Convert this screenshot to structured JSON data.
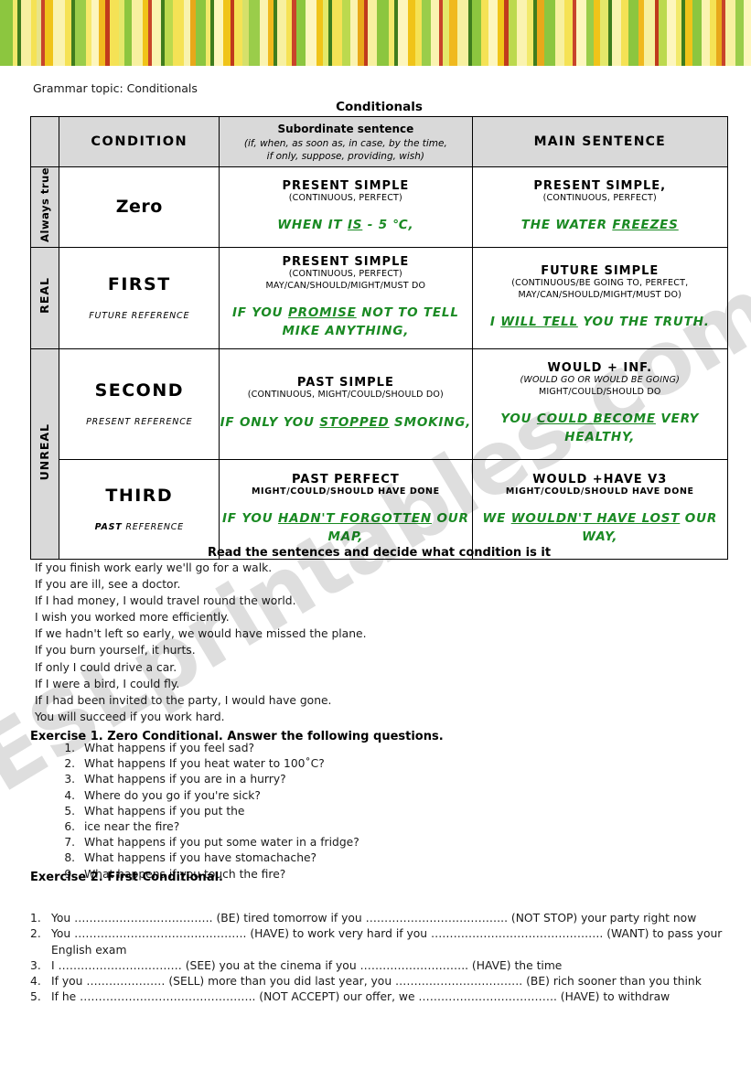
{
  "banner": {
    "name": "decorative-stripe-banner",
    "stripes": [
      {
        "c": "#8cc63f",
        "w": 14
      },
      {
        "c": "#f2e96b",
        "w": 5
      },
      {
        "c": "#3f7d1e",
        "w": 4
      },
      {
        "c": "#f7f0a0",
        "w": 11
      },
      {
        "c": "#f5e255",
        "w": 6
      },
      {
        "c": "#e8e48a",
        "w": 5
      },
      {
        "c": "#c8442a",
        "w": 4
      },
      {
        "c": "#f0c419",
        "w": 9
      },
      {
        "c": "#faf3b0",
        "w": 13
      },
      {
        "c": "#f5e255",
        "w": 7
      },
      {
        "c": "#3f7d1e",
        "w": 4
      },
      {
        "c": "#9acd4a",
        "w": 12
      },
      {
        "c": "#f7e96b",
        "w": 6
      },
      {
        "c": "#fdf6bd",
        "w": 9
      },
      {
        "c": "#f0b91e",
        "w": 7
      },
      {
        "c": "#c03a1c",
        "w": 5
      },
      {
        "c": "#f5e255",
        "w": 10
      },
      {
        "c": "#e4e86a",
        "w": 6
      },
      {
        "c": "#8cc63f",
        "w": 8
      },
      {
        "c": "#f7f0a0",
        "w": 12
      },
      {
        "c": "#f0c419",
        "w": 6
      },
      {
        "c": "#c8442a",
        "w": 4
      },
      {
        "c": "#faf3b0",
        "w": 10
      },
      {
        "c": "#3f7d1e",
        "w": 4
      },
      {
        "c": "#bcd94e",
        "w": 9
      },
      {
        "c": "#f5e255",
        "w": 12
      },
      {
        "c": "#f8f2ae",
        "w": 7
      },
      {
        "c": "#e8a81a",
        "w": 6
      },
      {
        "c": "#8cc63f",
        "w": 11
      },
      {
        "c": "#f2e96b",
        "w": 5
      },
      {
        "c": "#3f7d1e",
        "w": 4
      },
      {
        "c": "#fdf6bd",
        "w": 10
      },
      {
        "c": "#f0c419",
        "w": 8
      },
      {
        "c": "#c03a1c",
        "w": 4
      },
      {
        "c": "#f5e255",
        "w": 9
      },
      {
        "c": "#d6e06a",
        "w": 7
      },
      {
        "c": "#9acd4a",
        "w": 12
      },
      {
        "c": "#faf3b0",
        "w": 9
      },
      {
        "c": "#f0b91e",
        "w": 6
      },
      {
        "c": "#3f7d1e",
        "w": 4
      },
      {
        "c": "#f7f0a0",
        "w": 11
      },
      {
        "c": "#f5e255",
        "w": 6
      },
      {
        "c": "#c8442a",
        "w": 5
      },
      {
        "c": "#8cc63f",
        "w": 10
      },
      {
        "c": "#fdf6bd",
        "w": 12
      },
      {
        "c": "#f0c419",
        "w": 7
      },
      {
        "c": "#e4e86a",
        "w": 6
      },
      {
        "c": "#3f7d1e",
        "w": 4
      },
      {
        "c": "#f5e255",
        "w": 11
      },
      {
        "c": "#bcd94e",
        "w": 9
      },
      {
        "c": "#faf3b0",
        "w": 8
      },
      {
        "c": "#e8a81a",
        "w": 7
      },
      {
        "c": "#c03a1c",
        "w": 4
      },
      {
        "c": "#f7f0a0",
        "w": 10
      },
      {
        "c": "#8cc63f",
        "w": 13
      },
      {
        "c": "#f2e96b",
        "w": 6
      },
      {
        "c": "#3f7d1e",
        "w": 4
      },
      {
        "c": "#fdf6bd",
        "w": 11
      },
      {
        "c": "#f0c419",
        "w": 8
      },
      {
        "c": "#f5e255",
        "w": 7
      },
      {
        "c": "#9acd4a",
        "w": 10
      },
      {
        "c": "#faf3b0",
        "w": 9
      },
      {
        "c": "#c8442a",
        "w": 4
      },
      {
        "c": "#e4e86a",
        "w": 7
      },
      {
        "c": "#f0b91e",
        "w": 9
      },
      {
        "c": "#f7f0a0",
        "w": 12
      },
      {
        "c": "#3f7d1e",
        "w": 4
      },
      {
        "c": "#8cc63f",
        "w": 11
      },
      {
        "c": "#f5e255",
        "w": 8
      },
      {
        "c": "#fdf6bd",
        "w": 10
      },
      {
        "c": "#f0c419",
        "w": 7
      },
      {
        "c": "#c03a1c",
        "w": 5
      },
      {
        "c": "#bcd94e",
        "w": 9
      },
      {
        "c": "#faf3b0",
        "w": 11
      },
      {
        "c": "#f2e96b",
        "w": 7
      },
      {
        "c": "#3f7d1e",
        "w": 4
      },
      {
        "c": "#e8a81a",
        "w": 8
      },
      {
        "c": "#8cc63f",
        "w": 12
      },
      {
        "c": "#f7f0a0",
        "w": 10
      },
      {
        "c": "#f5e255",
        "w": 9
      },
      {
        "c": "#c8442a",
        "w": 4
      },
      {
        "c": "#fdf6bd",
        "w": 11
      },
      {
        "c": "#9acd4a",
        "w": 8
      },
      {
        "c": "#f0c419",
        "w": 7
      },
      {
        "c": "#e4e86a",
        "w": 9
      },
      {
        "c": "#3f7d1e",
        "w": 4
      },
      {
        "c": "#faf3b0",
        "w": 10
      },
      {
        "c": "#f5e255",
        "w": 8
      },
      {
        "c": "#8cc63f",
        "w": 11
      },
      {
        "c": "#f0b91e",
        "w": 6
      },
      {
        "c": "#f7f0a0",
        "w": 12
      },
      {
        "c": "#c03a1c",
        "w": 4
      },
      {
        "c": "#bcd94e",
        "w": 9
      },
      {
        "c": "#fdf6bd",
        "w": 10
      },
      {
        "c": "#f2e96b",
        "w": 7
      },
      {
        "c": "#3f7d1e",
        "w": 4
      },
      {
        "c": "#f0c419",
        "w": 8
      },
      {
        "c": "#8cc63f",
        "w": 10
      },
      {
        "c": "#faf3b0",
        "w": 9
      },
      {
        "c": "#f5e255",
        "w": 7
      },
      {
        "c": "#e8a81a",
        "w": 6
      },
      {
        "c": "#c8442a",
        "w": 4
      },
      {
        "c": "#f7f0a0",
        "w": 11
      },
      {
        "c": "#9acd4a",
        "w": 9
      },
      {
        "c": "#fdf6bd",
        "w": 8
      }
    ]
  },
  "watermark": {
    "text": "ESLprintables.com"
  },
  "topic": "Grammar topic: Conditionals",
  "table": {
    "title": "Conditionals",
    "headers": {
      "side": "",
      "condition": "CONDITION",
      "subordinate_title": "Subordinate sentence",
      "subordinate_sub_line1": "(if, when, as soon as, in case, by the time,",
      "subordinate_sub_line2": "if only, suppose, providing, wish)",
      "main": "MAIN SENTENCE"
    },
    "side_labels": {
      "always_true_line1": "Always",
      "always_true_line2": "true",
      "real": "REAL",
      "unreal": "UNREAL"
    },
    "rows": [
      {
        "name": "Zero",
        "reference_bold": "",
        "reference_rest": "",
        "sub_form": "PRESENT SIMPLE",
        "sub_notes": [
          "(CONTINUOUS, PERFECT)"
        ],
        "sub_example_pre": "WHEN IT ",
        "sub_example_u": "IS",
        "sub_example_post": " - 5 ℃,",
        "main_form": "PRESENT SIMPLE,",
        "main_notes": [
          "(CONTINUOUS, PERFECT)"
        ],
        "main_example_pre": "THE WATER ",
        "main_example_u": "FREEZES",
        "main_example_post": ""
      },
      {
        "name": "FIRST",
        "reference_bold": "",
        "reference_rest": "FUTURE REFERENCE",
        "sub_form": "PRESENT SIMPLE",
        "sub_notes": [
          "(CONTINUOUS, PERFECT)",
          "MAY/CAN/SHOULD/MIGHT/MUST DO"
        ],
        "sub_example_pre": "IF YOU ",
        "sub_example_u": "PROMISE",
        "sub_example_post": " NOT TO TELL MIKE ANYTHING,",
        "main_form": "FUTURE SIMPLE",
        "main_notes": [
          "(CONTINUOUS/BE GOING TO, PERFECT,",
          "MAY/CAN/SHOULD/MIGHT/MUST DO)"
        ],
        "main_example_pre": "I ",
        "main_example_u": "WILL TELL",
        "main_example_post": " YOU THE TRUTH."
      },
      {
        "name": "SECOND",
        "reference_bold": "",
        "reference_rest": "PRESENT REFERENCE",
        "sub_form": "PAST SIMPLE",
        "sub_notes": [
          "(CONTINUOUS, MIGHT/COULD/SHOULD DO)"
        ],
        "sub_example_pre": "IF ONLY YOU ",
        "sub_example_u": "STOPPED",
        "sub_example_post": " SMOKING,",
        "main_form": "WOULD + INF.",
        "main_notes": [
          "(WOULD GO OR WOULD BE GOING)",
          "MIGHT/COULD/SHOULD DO"
        ],
        "main_example_pre": "YOU ",
        "main_example_u": "COULD BECOME",
        "main_example_post": " VERY HEALTHY,"
      },
      {
        "name": "THIRD",
        "reference_bold": "PAST",
        "reference_rest": " REFERENCE",
        "sub_form": "PAST PERFECT",
        "sub_notes": [
          "MIGHT/COULD/SHOULD HAVE DONE"
        ],
        "sub_example_pre": "IF YOU ",
        "sub_example_u": "HADN'T FORGOTTEN",
        "sub_example_post": " OUR MAP,",
        "main_form": "WOULD +HAVE V3",
        "main_notes": [
          "MIGHT/COULD/SHOULD HAVE DONE"
        ],
        "main_example_pre": "WE ",
        "main_example_u": "WOULDN'T HAVE LOST",
        "main_example_post": " OUR WAY,"
      }
    ]
  },
  "read_task": {
    "title": "Read the sentences and decide what condition is it",
    "sentences": [
      "If you finish work early we'll go for a walk.",
      "If you are ill, see a doctor.",
      "If I had money, I would travel round the world.",
      "I wish you worked more efficiently.",
      "If we hadn't left so early, we would have missed the plane.",
      "If you burn yourself, it hurts.",
      "If only I could drive a car.",
      "If I were a bird, I could fly.",
      "If I had been invited to the party, I would have gone.",
      "You will succeed if you work hard."
    ]
  },
  "exercise1": {
    "heading": "Exercise 1. Zero Conditional. Answer the following questions.",
    "questions": [
      "What happens if you feel sad?",
      "What happens If you heat water to 100˚C?",
      "What happens if you are in a hurry?",
      "Where do you go if you're sick?",
      "What happens if you put the",
      "ice near the fire?",
      "What happens if you put some water in a fridge?",
      "What happens if you have stomachache?",
      "What happens if you touch the fire?"
    ]
  },
  "exercise2": {
    "heading": "Exercise 2. First Conditional.",
    "items": [
      {
        "num": "1.",
        "text": "You ………………………………. (BE) tired tomorrow if you ……………………………….. (NOT STOP) your party right now"
      },
      {
        "num": "2.",
        "text": "You ………………………………………. (HAVE) to work very hard if you ………………………………………. (WANT) to pass your English exam"
      },
      {
        "num": "3.",
        "text": "I …………………………… (SEE) you at the cinema if you ……………………….. (HAVE) the time"
      },
      {
        "num": "4.",
        "text": "If you ………………… (SELL) more than you did last year, you ……………………………. (BE) rich sooner than you think"
      },
      {
        "num": "5.",
        "text": "If he ……………………………………….. (NOT ACCEPT) our offer, we ………………………………. (HAVE) to withdraw"
      }
    ]
  }
}
